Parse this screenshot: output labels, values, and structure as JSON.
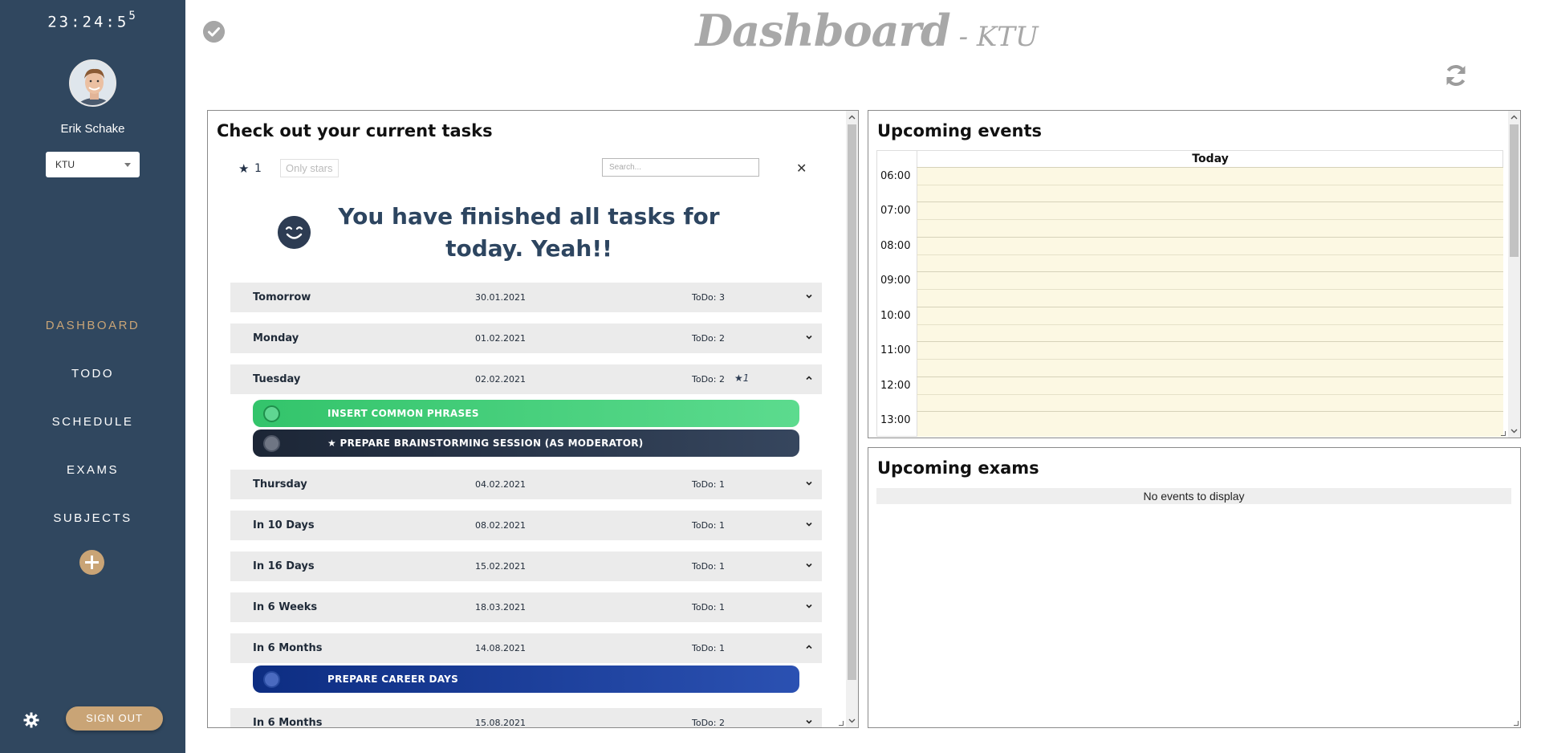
{
  "sidebar": {
    "clock_main": "23:24:5",
    "clock_sup": "5",
    "username": "Erik Schake",
    "school_select": "KTU",
    "nav": [
      {
        "label": "DASHBOARD",
        "active": true
      },
      {
        "label": "TODO",
        "active": false
      },
      {
        "label": "SCHEDULE",
        "active": false
      },
      {
        "label": "EXAMS",
        "active": false
      },
      {
        "label": "SUBJECTS",
        "active": false
      }
    ],
    "signout_label": "SIGN OUT"
  },
  "header": {
    "title_main": "Dashboard",
    "title_suffix": " - KTU"
  },
  "tasks": {
    "heading": "Check out your current tasks",
    "star_count": "1",
    "only_stars_label": "Only stars",
    "search_placeholder": "Search...",
    "clear_label": "✕",
    "finished_message": "You have finished all tasks for today. Yeah!!",
    "days": [
      {
        "day": "Tomorrow",
        "date": "30.01.2021",
        "todo": "ToDo: 3",
        "expanded": false
      },
      {
        "day": "Monday",
        "date": "01.02.2021",
        "todo": "ToDo: 2",
        "expanded": false
      },
      {
        "day": "Tuesday",
        "date": "02.02.2021",
        "todo": "ToDo: 2",
        "stars": "1",
        "expanded": true,
        "tasks": [
          {
            "label": "INSERT COMMON PHRASES",
            "color": "green",
            "starred": false
          },
          {
            "label": "PREPARE BRAINSTORMING SESSION (AS MODERATOR)",
            "color": "dark",
            "starred": true
          }
        ]
      },
      {
        "day": "Thursday",
        "date": "04.02.2021",
        "todo": "ToDo: 1",
        "expanded": false
      },
      {
        "day": "In 10 Days",
        "date": "08.02.2021",
        "todo": "ToDo: 1",
        "expanded": false
      },
      {
        "day": "In 16 Days",
        "date": "15.02.2021",
        "todo": "ToDo: 1",
        "expanded": false
      },
      {
        "day": "In 6 Weeks",
        "date": "18.03.2021",
        "todo": "ToDo: 1",
        "expanded": false
      },
      {
        "day": "In 6 Months",
        "date": "14.08.2021",
        "todo": "ToDo: 1",
        "expanded": true,
        "tasks": [
          {
            "label": "PREPARE CAREER DAYS",
            "color": "blue",
            "starred": false
          }
        ]
      },
      {
        "day": "In 6 Months",
        "date": "15.08.2021",
        "todo": "ToDo: 2",
        "expanded": false
      }
    ]
  },
  "events": {
    "heading": "Upcoming events",
    "column_header": "Today",
    "times": [
      "06:00",
      "07:00",
      "08:00",
      "09:00",
      "10:00",
      "11:00",
      "12:00",
      "13:00"
    ]
  },
  "exams": {
    "heading": "Upcoming exams",
    "empty_message": "No events to display"
  },
  "colors": {
    "sidebar_bg": "#30475f",
    "accent_gold": "#c9a476",
    "task_green": "#3fcf78",
    "task_dark": "#253246",
    "task_blue": "#173a96",
    "calendar_today_bg": "#fcf8e3"
  },
  "icons": [
    "check-circle-icon",
    "refresh-icon",
    "gear-icon",
    "plus-icon",
    "star-icon",
    "smiley-icon",
    "chevron-down-icon",
    "chevron-up-icon",
    "caret-down-icon"
  ]
}
